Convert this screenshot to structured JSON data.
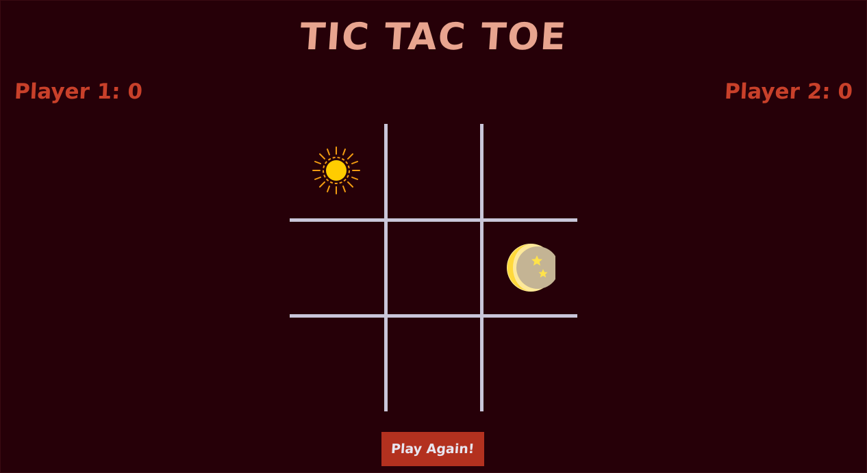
{
  "game": {
    "title": "TIC TAC TOE",
    "player1_score": "Player 1: 0",
    "player2_score": "Player 2: 0",
    "play_again_label": "Play Again!",
    "board": [
      "sun",
      "",
      "",
      "",
      "",
      "moon",
      "",
      "",
      ""
    ]
  },
  "colors": {
    "background": "#260008",
    "title": "#e8a48f",
    "score": "#c8402a",
    "grid": "#c9c6d9",
    "button": "#b3311f",
    "button_text": "#e8e6f0"
  },
  "icons": {
    "sun": "sun-icon",
    "moon": "moon-icon"
  }
}
